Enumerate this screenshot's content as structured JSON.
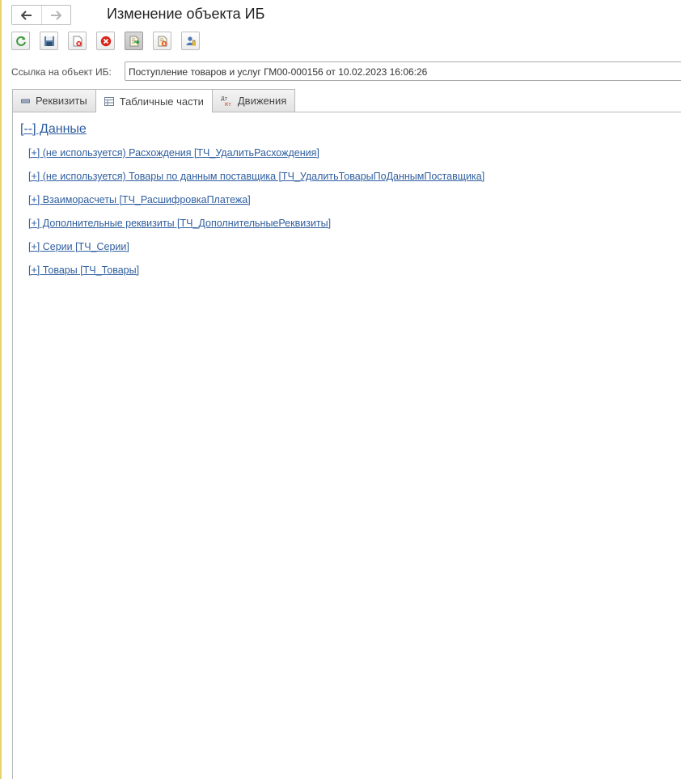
{
  "window": {
    "title": "Изменение объекта ИБ"
  },
  "nav": {
    "back_icon": "arrow-left-icon",
    "forward_icon": "arrow-right-icon"
  },
  "toolbar": {
    "buttons": [
      {
        "icon": "refresh-icon"
      },
      {
        "icon": "save-icon"
      },
      {
        "icon": "delete-document-icon"
      },
      {
        "icon": "cancel-icon"
      },
      {
        "icon": "export-icon",
        "pressed": true
      },
      {
        "icon": "import-document-icon"
      },
      {
        "icon": "user-access-icon"
      }
    ]
  },
  "reference": {
    "label": "Ссылка на объект ИБ:",
    "value": "Поступление товаров и услуг ГМ00-000156 от 10.02.2023 16:06:26"
  },
  "tabs": [
    {
      "label": "Реквизиты",
      "icon": "minus-icon",
      "active": false
    },
    {
      "label": "Табличные части",
      "icon": "table-icon",
      "active": true
    },
    {
      "label": "Движения",
      "icon": "dt-kt-icon",
      "active": false
    }
  ],
  "content": {
    "group_header": "[--] Данные",
    "items": [
      "[+] (не используется) Расхождения [ТЧ_УдалитьРасхождения]",
      "[+] (не используется) Товары по данным поставщика [ТЧ_УдалитьТоварыПоДаннымПоставщика]",
      "[+] Взаиморасчеты [ТЧ_РасшифровкаПлатежа]",
      "[+] Дополнительные реквизиты [ТЧ_ДополнительныеРеквизиты]",
      "[+] Серии [ТЧ_Серии]",
      "[+] Товары [ТЧ_Товары]"
    ]
  },
  "colors": {
    "link": "#2f5e9f",
    "accent_edge": "#e8d36a",
    "border": "#b8b8b8"
  }
}
